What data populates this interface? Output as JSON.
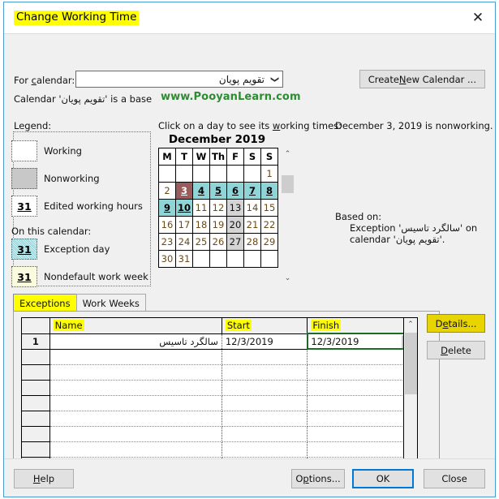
{
  "window": {
    "title": "Change Working Time",
    "close_icon": "close-icon"
  },
  "calendar_select": {
    "label": "For calendar:",
    "label_pre": "For ",
    "label_accel": "c",
    "label_post": "alendar:",
    "value": "تقویم پویان",
    "arrow": "⌄"
  },
  "create_button": {
    "pre": "Create ",
    "accel": "N",
    "post": "ew Calendar ..."
  },
  "base_line": {
    "pre": "Calendar '",
    "name": "تقویم پویان",
    "post": "' is a base"
  },
  "watermark": "www.PooyanLearn.com",
  "legend": {
    "title": "Legend:",
    "items": [
      {
        "swatch": "working",
        "glyph": "",
        "label": "Working"
      },
      {
        "swatch": "nonworking",
        "glyph": "",
        "label": "Nonworking"
      },
      {
        "swatch": "edited",
        "glyph": "31",
        "label": "Edited working hours"
      }
    ],
    "subheading": "On this calendar:",
    "items2": [
      {
        "swatch": "exception",
        "glyph": "31",
        "label": "Exception day"
      },
      {
        "swatch": "nondefault",
        "glyph": "31",
        "label": "Nondefault work week"
      }
    ]
  },
  "calendar": {
    "hint_pre": "Click on a day to see its ",
    "hint_accel": "w",
    "hint_post": "orking times:",
    "month_title": "December 2019",
    "weekday_headers": [
      "M",
      "T",
      "W",
      "Th",
      "F",
      "S",
      "S"
    ],
    "weeks": [
      [
        {
          "d": "",
          "state": "empty"
        },
        {
          "d": "",
          "state": "empty"
        },
        {
          "d": "",
          "state": "empty"
        },
        {
          "d": "",
          "state": "empty"
        },
        {
          "d": "",
          "state": "empty"
        },
        {
          "d": "",
          "state": "empty"
        },
        {
          "d": "1",
          "state": "work"
        }
      ],
      [
        {
          "d": "2",
          "state": "work"
        },
        {
          "d": "3",
          "state": "selected"
        },
        {
          "d": "4",
          "state": "exception"
        },
        {
          "d": "5",
          "state": "exception"
        },
        {
          "d": "6",
          "state": "exception"
        },
        {
          "d": "7",
          "state": "exception"
        },
        {
          "d": "8",
          "state": "exception"
        }
      ],
      [
        {
          "d": "9",
          "state": "exception"
        },
        {
          "d": "10",
          "state": "exception"
        },
        {
          "d": "11",
          "state": "work"
        },
        {
          "d": "12",
          "state": "work"
        },
        {
          "d": "13",
          "state": "nonworking"
        },
        {
          "d": "14",
          "state": "work"
        },
        {
          "d": "15",
          "state": "work"
        }
      ],
      [
        {
          "d": "16",
          "state": "work"
        },
        {
          "d": "17",
          "state": "work"
        },
        {
          "d": "18",
          "state": "work"
        },
        {
          "d": "19",
          "state": "work"
        },
        {
          "d": "20",
          "state": "nonworking"
        },
        {
          "d": "21",
          "state": "work"
        },
        {
          "d": "22",
          "state": "work"
        }
      ],
      [
        {
          "d": "23",
          "state": "work"
        },
        {
          "d": "24",
          "state": "work"
        },
        {
          "d": "25",
          "state": "work"
        },
        {
          "d": "26",
          "state": "work"
        },
        {
          "d": "27",
          "state": "nonworking"
        },
        {
          "d": "28",
          "state": "work"
        },
        {
          "d": "29",
          "state": "work"
        }
      ],
      [
        {
          "d": "30",
          "state": "work"
        },
        {
          "d": "31",
          "state": "work"
        },
        {
          "d": "",
          "state": "empty"
        },
        {
          "d": "",
          "state": "empty"
        },
        {
          "d": "",
          "state": "empty"
        },
        {
          "d": "",
          "state": "empty"
        },
        {
          "d": "",
          "state": "empty"
        }
      ]
    ],
    "scroll_up": "⌃",
    "scroll_down": "⌄"
  },
  "info": {
    "status": "December 3, 2019 is nonworking.",
    "based_on_label": "Based on:",
    "based_on_line1_pre": "Exception '",
    "based_on_exception": "سالگرد تاسیس",
    "based_on_line1_post": "' on",
    "based_on_line2_pre": "calendar '",
    "based_on_calendar": "تقویم پویان",
    "based_on_line2_post": "'."
  },
  "tabs": [
    {
      "label": "Exceptions",
      "active": true
    },
    {
      "label": "Work Weeks",
      "active": false
    }
  ],
  "table": {
    "columns": [
      "",
      "Name",
      "Start",
      "Finish"
    ],
    "rows": [
      {
        "index": "1",
        "name": "سالگرد تاسیس",
        "start": "12/3/2019",
        "finish": "12/3/2019"
      }
    ],
    "empty_row_count": 8,
    "active_cell": "finish",
    "cell_arrow": "⌄",
    "scroll_up": "⌃",
    "scroll_down": "⌄"
  },
  "side_buttons": {
    "details": {
      "pre": "D",
      "accel": "e",
      "post": "tails..."
    },
    "delete": {
      "pre": "",
      "accel": "D",
      "post": "elete"
    }
  },
  "footer": {
    "help": {
      "pre": "",
      "accel": "H",
      "post": "elp"
    },
    "options": {
      "pre": "O",
      "accel": "p",
      "post": "tions..."
    },
    "ok": "OK",
    "close": "Close"
  },
  "colors": {
    "accent": "#0078d7",
    "highlight": "#ffff00",
    "watermark_green": "#2e8b33",
    "active_cell_green": "#1e6b28",
    "details_yellow": "#e8d400",
    "exception_teal": "#1fa8ae",
    "selected_red": "#8c2b2b",
    "nonworking_gray": "#d4d4d4"
  }
}
